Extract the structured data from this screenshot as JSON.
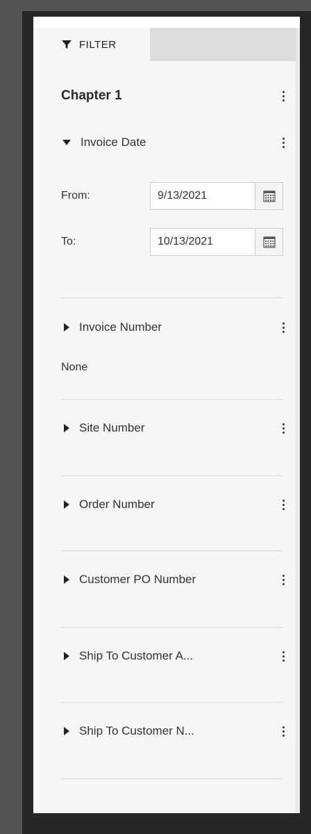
{
  "filter_tab": {
    "label": "FILTER",
    "icon": "filter-funnel-icon"
  },
  "chapter": {
    "title": "Chapter 1"
  },
  "sections": {
    "invoice_date": {
      "label": "Invoice Date",
      "expanded": true,
      "from_label": "From:",
      "from_value": "9/13/2021",
      "to_label": "To:",
      "to_value": "10/13/2021"
    },
    "invoice_number": {
      "label": "Invoice Number",
      "expanded": false,
      "value_text": "None"
    },
    "site_number": {
      "label": "Site Number",
      "expanded": false
    },
    "order_number": {
      "label": "Order Number",
      "expanded": false
    },
    "customer_po_number": {
      "label": "Customer PO Number",
      "expanded": false
    },
    "ship_to_customer_a": {
      "label": "Ship To Customer A...",
      "expanded": false
    },
    "ship_to_customer_n": {
      "label": "Ship To Customer N...",
      "expanded": false
    }
  },
  "colors": {
    "outer_frame": "#545454",
    "panel_background": "#f6f6f6",
    "inactive_tab": "#dcdcdc",
    "divider": "#d8d8d8"
  }
}
